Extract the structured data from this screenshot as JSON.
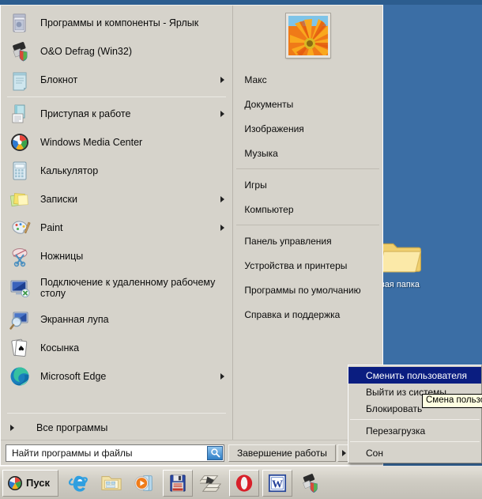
{
  "desktop": {
    "background_color": "#3b6ea5",
    "folder": {
      "label": "вая папка",
      "icon": "folder-icon"
    }
  },
  "start_menu": {
    "left_pane": {
      "groups": [
        {
          "items": [
            {
              "label": "Программы и компоненты - Ярлык",
              "icon": "programs-and-features-icon",
              "has_submenu": false
            },
            {
              "label": "O&O Defrag (Win32)",
              "icon": "oo-defrag-icon",
              "has_submenu": false
            },
            {
              "label": "Блокнот",
              "icon": "notepad-icon",
              "has_submenu": true
            }
          ]
        },
        {
          "items": [
            {
              "label": "Приступая к работе",
              "icon": "getting-started-icon",
              "has_submenu": true
            },
            {
              "label": "Windows Media Center",
              "icon": "windows-media-center-icon",
              "has_submenu": false
            },
            {
              "label": "Калькулятор",
              "icon": "calculator-icon",
              "has_submenu": false
            },
            {
              "label": "Записки",
              "icon": "sticky-notes-icon",
              "has_submenu": true
            },
            {
              "label": "Paint",
              "icon": "paint-icon",
              "has_submenu": true
            },
            {
              "label": "Ножницы",
              "icon": "snipping-tool-icon",
              "has_submenu": false
            },
            {
              "label": "Подключение к удаленному рабочему столу",
              "icon": "remote-desktop-icon",
              "has_submenu": false
            },
            {
              "label": "Экранная лупа",
              "icon": "magnifier-icon",
              "has_submenu": false
            },
            {
              "label": "Косынка",
              "icon": "solitaire-icon",
              "has_submenu": false
            },
            {
              "label": "Microsoft Edge",
              "icon": "microsoft-edge-icon",
              "has_submenu": true
            }
          ]
        }
      ],
      "all_programs": {
        "label": "Все программы"
      }
    },
    "right_pane": {
      "avatar": {
        "icon": "user-avatar-flower"
      },
      "groups": [
        {
          "items": [
            {
              "label": "Макс"
            },
            {
              "label": "Документы"
            },
            {
              "label": "Изображения"
            },
            {
              "label": "Музыка"
            }
          ]
        },
        {
          "items": [
            {
              "label": "Игры"
            },
            {
              "label": "Компьютер"
            }
          ]
        },
        {
          "items": [
            {
              "label": "Панель управления"
            },
            {
              "label": "Устройства и принтеры"
            },
            {
              "label": "Программы по умолчанию"
            },
            {
              "label": "Справка и поддержка"
            }
          ]
        }
      ]
    },
    "search": {
      "placeholder": "Найти программы и файлы",
      "value": "",
      "icon": "search-icon"
    },
    "shutdown": {
      "label": "Завершение работы",
      "arrow_icon": "chevron-right-icon"
    }
  },
  "context_menu": {
    "items": [
      {
        "label": "Сменить пользователя",
        "selected": true
      },
      {
        "label": "Выйти из системы",
        "selected": false
      },
      {
        "label": "Блокировать",
        "selected": false
      },
      {
        "label": "Перезагрузка",
        "selected": false
      },
      {
        "label": "Сон",
        "selected": false
      }
    ],
    "highlight_color": "#0a1d80"
  },
  "tooltip": {
    "text": "Смена пользов"
  },
  "taskbar": {
    "start_button": {
      "label": "Пуск",
      "icon": "windows-logo-icon"
    },
    "items": [
      {
        "icon": "internet-explorer-icon",
        "framed": false
      },
      {
        "icon": "file-explorer-icon",
        "framed": false
      },
      {
        "icon": "media-player-icon",
        "framed": false
      },
      {
        "icon": "floppy-save-icon",
        "framed": true
      },
      {
        "icon": "winamp-icon",
        "framed": false
      },
      {
        "icon": "opera-icon",
        "framed": true
      },
      {
        "icon": "word-icon",
        "framed": true
      },
      {
        "icon": "oo-defrag-taskbar-icon",
        "framed": false
      }
    ]
  }
}
